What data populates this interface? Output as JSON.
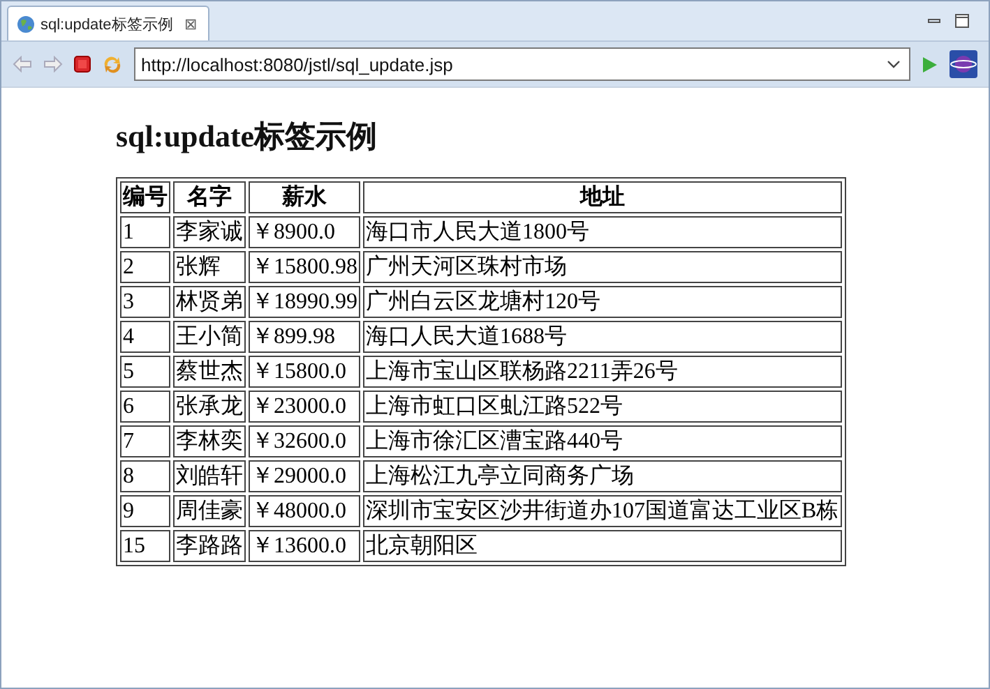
{
  "tab": {
    "title": "sql:update标签示例",
    "close": "⊠"
  },
  "address": {
    "value": "http://localhost:8080/jstl/sql_update.jsp"
  },
  "page": {
    "heading": "sql:update标签示例"
  },
  "table": {
    "columns": [
      "编号",
      "名字",
      "薪水",
      "地址"
    ],
    "rows": [
      [
        "1",
        "李家诚",
        "￥8900.0",
        "海口市人民大道1800号"
      ],
      [
        "2",
        "张辉",
        "￥15800.98",
        "广州天河区珠村市场"
      ],
      [
        "3",
        "林贤弟",
        "￥18990.99",
        "广州白云区龙塘村120号"
      ],
      [
        "4",
        "王小简",
        "￥899.98",
        "海口人民大道1688号"
      ],
      [
        "5",
        "蔡世杰",
        "￥15800.0",
        "上海市宝山区联杨路2211弄26号"
      ],
      [
        "6",
        "张承龙",
        "￥23000.0",
        "上海市虹口区虬江路522号"
      ],
      [
        "7",
        "李林奕",
        "￥32600.0",
        "上海市徐汇区漕宝路440号"
      ],
      [
        "8",
        "刘皓轩",
        "￥29000.0",
        "上海松江九亭立同商务广场"
      ],
      [
        "9",
        "周佳豪",
        "￥48000.0",
        "深圳市宝安区沙井街道办107国道富达工业区B栋"
      ],
      [
        "15",
        "李路路",
        "￥13600.0",
        "北京朝阳区"
      ]
    ]
  }
}
